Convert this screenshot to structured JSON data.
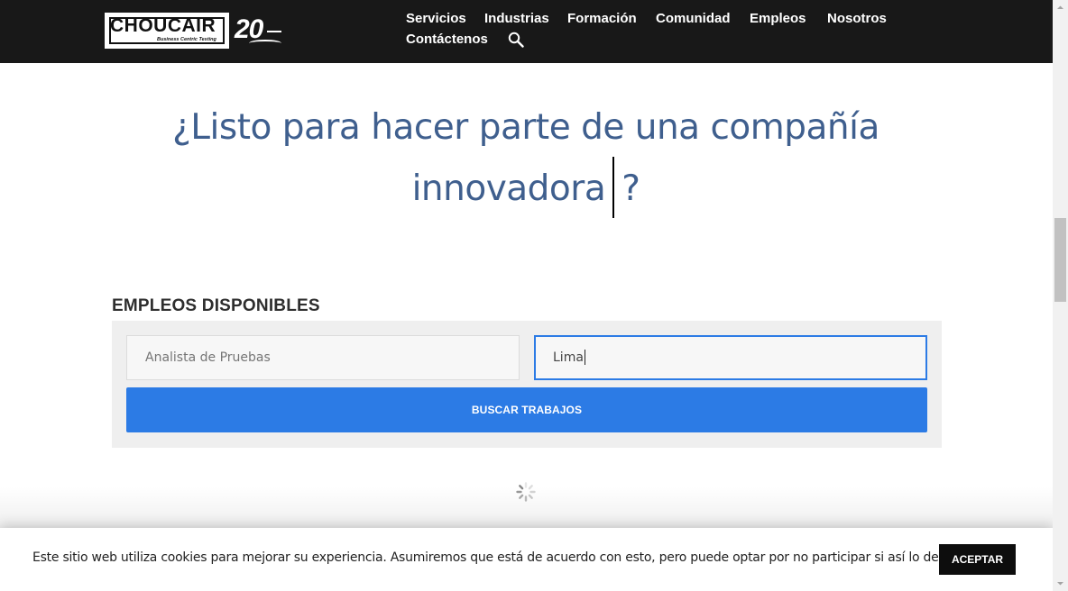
{
  "header": {
    "logo": {
      "brand": "CHOUCAIR",
      "tagline": "Business Centric Testing",
      "anniversary": "20"
    },
    "nav": [
      {
        "label": "Servicios"
      },
      {
        "label": "Industrias"
      },
      {
        "label": "Formación"
      },
      {
        "label": "Comunidad"
      },
      {
        "label": "Empleos"
      },
      {
        "label": "Nosotros"
      },
      {
        "label": "Contáctenos"
      }
    ]
  },
  "hero": {
    "line1": "¿Listo para hacer parte de una compañía",
    "line2_word": "innovadora",
    "line2_end": "?"
  },
  "jobs": {
    "heading": "EMPLEOS DISPONIBLES",
    "keywords_placeholder": "Analista de Pruebas",
    "location_value": "Lima",
    "search_button": "BUSCAR TRABAJOS"
  },
  "cookie": {
    "text": "Este sitio web utiliza cookies para mejorar su experiencia. Asumiremos que está de acuerdo con esto, pero puede optar por no participar si así lo desea.",
    "accept": "ACEPTAR"
  },
  "colors": {
    "header_bg": "#181818",
    "title_blue": "#3f5f8e",
    "button_blue": "#2c7be5",
    "accept_bg": "#0d0d0d"
  }
}
